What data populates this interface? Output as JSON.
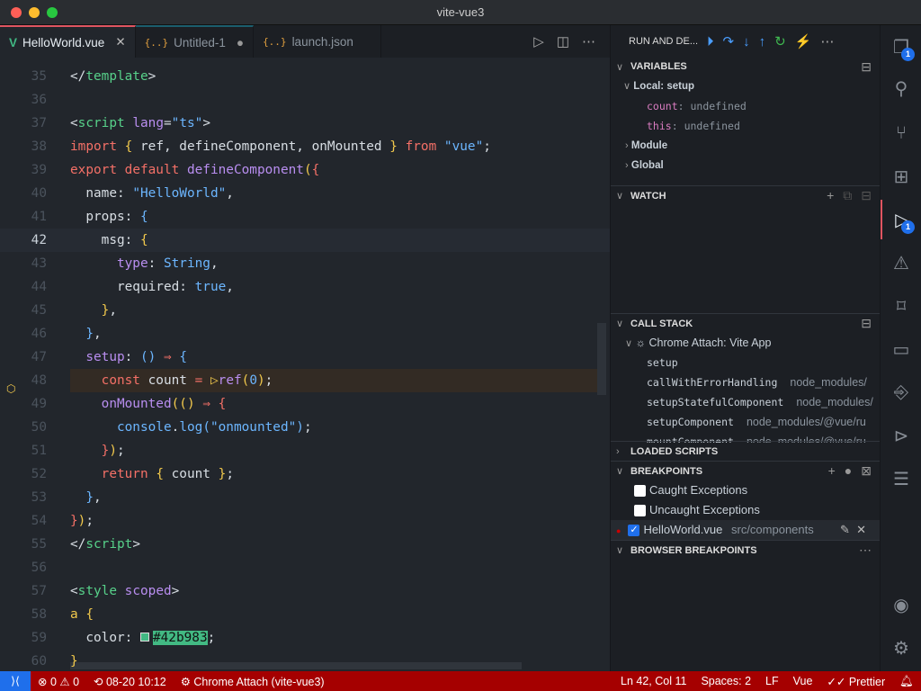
{
  "window": {
    "title": "vite-vue3"
  },
  "tabs": [
    {
      "label": "HelloWorld.vue",
      "icon": "vue-icon",
      "state": "active-close"
    },
    {
      "label": "Untitled-1",
      "icon": "json-icon",
      "state": "dirty"
    },
    {
      "label": "launch.json",
      "icon": "json-icon",
      "state": "normal"
    }
  ],
  "editor": {
    "current_line": 42,
    "stopped_line": 48,
    "lines": [
      {
        "n": 35,
        "t": [
          [
            "pu",
            "</"
          ],
          [
            "tag",
            "template"
          ],
          [
            "pu",
            ">"
          ]
        ]
      },
      {
        "n": 36,
        "t": []
      },
      {
        "n": 37,
        "t": [
          [
            "pu",
            "<"
          ],
          [
            "tag",
            "script"
          ],
          [
            "pl",
            " "
          ],
          [
            "attr",
            "lang"
          ],
          [
            "pu",
            "="
          ],
          [
            "str",
            "\"ts\""
          ],
          [
            "pu",
            ">"
          ]
        ]
      },
      {
        "n": 38,
        "t": [
          [
            "kw",
            "import"
          ],
          [
            "pl",
            " "
          ],
          [
            "br",
            "{"
          ],
          [
            "pl",
            " ref, defineComponent, onMounted "
          ],
          [
            "br",
            "}"
          ],
          [
            "pl",
            " "
          ],
          [
            "kw",
            "from"
          ],
          [
            "pl",
            " "
          ],
          [
            "str",
            "\"vue\""
          ],
          [
            "pl",
            ";"
          ]
        ]
      },
      {
        "n": 39,
        "t": [
          [
            "kw",
            "export"
          ],
          [
            "pl",
            " "
          ],
          [
            "kw",
            "default"
          ],
          [
            "pl",
            " "
          ],
          [
            "fn",
            "defineComponent"
          ],
          [
            "br",
            "("
          ],
          [
            "kw",
            "{"
          ]
        ]
      },
      {
        "n": 40,
        "t": [
          [
            "pl",
            "  name: "
          ],
          [
            "str",
            "\"HelloWorld\""
          ],
          [
            "pl",
            ","
          ]
        ]
      },
      {
        "n": 41,
        "t": [
          [
            "pl",
            "  props: "
          ],
          [
            "str",
            "{"
          ]
        ]
      },
      {
        "n": 42,
        "t": [
          [
            "pl",
            "    msg: "
          ],
          [
            "br",
            "{"
          ]
        ]
      },
      {
        "n": 43,
        "t": [
          [
            "pl",
            "      "
          ],
          [
            "fn",
            "type"
          ],
          [
            "pl",
            ": "
          ],
          [
            "str",
            "String"
          ],
          [
            "pl",
            ","
          ]
        ]
      },
      {
        "n": 44,
        "t": [
          [
            "pl",
            "      required: "
          ],
          [
            "str",
            "true"
          ],
          [
            "pl",
            ","
          ]
        ]
      },
      {
        "n": 45,
        "t": [
          [
            "pl",
            "    "
          ],
          [
            "br",
            "}"
          ],
          [
            "pl",
            ","
          ]
        ]
      },
      {
        "n": 46,
        "t": [
          [
            "pl",
            "  "
          ],
          [
            "str",
            "}"
          ],
          [
            "pl",
            ","
          ]
        ]
      },
      {
        "n": 47,
        "t": [
          [
            "pl",
            "  "
          ],
          [
            "fn",
            "setup"
          ],
          [
            "pl",
            ": "
          ],
          [
            "str",
            "()"
          ],
          [
            "pl",
            " "
          ],
          [
            "arr",
            "⇒"
          ],
          [
            "pl",
            " "
          ],
          [
            "str",
            "{"
          ]
        ]
      },
      {
        "n": 48,
        "t": [
          [
            "pl",
            "    "
          ],
          [
            "kw",
            "const"
          ],
          [
            "pl",
            " count "
          ],
          [
            "arr",
            "="
          ],
          [
            "pl",
            " "
          ],
          [
            "br",
            "▷"
          ],
          [
            "fn",
            "ref"
          ],
          [
            "br",
            "("
          ],
          [
            "num",
            "0"
          ],
          [
            "br",
            ")"
          ],
          [
            "pl",
            ";"
          ]
        ]
      },
      {
        "n": 49,
        "t": [
          [
            "pl",
            "    "
          ],
          [
            "fn",
            "onMounted"
          ],
          [
            "br",
            "(()"
          ],
          [
            "pl",
            " "
          ],
          [
            "arr",
            "⇒"
          ],
          [
            "pl",
            " "
          ],
          [
            "kw",
            "{"
          ]
        ]
      },
      {
        "n": 50,
        "t": [
          [
            "pl",
            "      "
          ],
          [
            "str",
            "console"
          ],
          [
            "pl",
            "."
          ],
          [
            "str",
            "log"
          ],
          [
            "str",
            "(\"onmounted\")"
          ],
          [
            "pl",
            ";"
          ]
        ]
      },
      {
        "n": 51,
        "t": [
          [
            "pl",
            "    "
          ],
          [
            "kw",
            "}"
          ],
          [
            "br",
            ")"
          ],
          [
            "pl",
            ";"
          ]
        ]
      },
      {
        "n": 52,
        "t": [
          [
            "pl",
            "    "
          ],
          [
            "kw",
            "return"
          ],
          [
            "pl",
            " "
          ],
          [
            "br",
            "{"
          ],
          [
            "pl",
            " count "
          ],
          [
            "br",
            "}"
          ],
          [
            "pl",
            ";"
          ]
        ]
      },
      {
        "n": 53,
        "t": [
          [
            "pl",
            "  "
          ],
          [
            "str",
            "}"
          ],
          [
            "pl",
            ","
          ]
        ]
      },
      {
        "n": 54,
        "t": [
          [
            "kw",
            "}"
          ],
          [
            "br",
            ")"
          ],
          [
            "pl",
            ";"
          ]
        ]
      },
      {
        "n": 55,
        "t": [
          [
            "pu",
            "</"
          ],
          [
            "tag",
            "script"
          ],
          [
            "pu",
            ">"
          ]
        ]
      },
      {
        "n": 56,
        "t": []
      },
      {
        "n": 57,
        "t": [
          [
            "pu",
            "<"
          ],
          [
            "tag",
            "style"
          ],
          [
            "pl",
            " "
          ],
          [
            "attr",
            "scoped"
          ],
          [
            "pu",
            ">"
          ]
        ]
      },
      {
        "n": 58,
        "t": [
          [
            "br",
            "a"
          ],
          [
            "pl",
            " "
          ],
          [
            "br",
            "{"
          ]
        ]
      },
      {
        "n": 59,
        "t": [
          [
            "pl",
            "  "
          ],
          [
            "pl",
            "color: "
          ],
          [
            "swatch",
            "#42b983"
          ],
          [
            "pl",
            ";"
          ]
        ]
      },
      {
        "n": 60,
        "t": [
          [
            "br",
            "}"
          ]
        ]
      }
    ]
  },
  "debug": {
    "title": "RUN AND DE...",
    "toolbar": [
      "continue-icon",
      "step-over-icon",
      "step-into-icon",
      "step-out-icon",
      "restart-icon",
      "disconnect-icon",
      "more-icon"
    ],
    "variables": {
      "title": "VARIABLES",
      "scope": "Local: setup",
      "vars": [
        {
          "name": "count",
          "value": "undefined"
        },
        {
          "name": "this",
          "value": "undefined"
        }
      ],
      "others": [
        "Module",
        "Global"
      ]
    },
    "watch": {
      "title": "WATCH"
    },
    "call_stack": {
      "title": "CALL STACK",
      "session": "Chrome Attach: Vite App",
      "frames": [
        {
          "name": "setup",
          "file": ""
        },
        {
          "name": "callWithErrorHandling",
          "file": "node_modules/"
        },
        {
          "name": "setupStatefulComponent",
          "file": "node_modules/"
        },
        {
          "name": "setupComponent",
          "file": "node_modules/@vue/ru"
        },
        {
          "name": "mountComponent",
          "file": "node_modules/@vue/ru"
        }
      ]
    },
    "loaded_scripts": {
      "title": "LOADED SCRIPTS"
    },
    "breakpoints": {
      "title": "BREAKPOINTS",
      "items": [
        {
          "label": "Caught Exceptions",
          "checked": false
        },
        {
          "label": "Uncaught Exceptions",
          "checked": false
        },
        {
          "label": "HelloWorld.vue",
          "path": "src/components",
          "checked": true
        }
      ]
    },
    "browser_breakpoints": {
      "title": "BROWSER BREAKPOINTS"
    }
  },
  "activity": {
    "explorer_badge": "1",
    "debug_badge": "1"
  },
  "status": {
    "errors": "0",
    "warnings": "0",
    "timeline": "08-20 10:12",
    "debug_session": "Chrome Attach (vite-vue3)",
    "position": "Ln 42, Col 11",
    "spaces": "Spaces: 2",
    "eol": "LF",
    "language": "Vue",
    "formatter": "Prettier"
  },
  "colors": {
    "statusbar": "#a50000",
    "accent": "#1f6feb",
    "active_tab_border": "#e05561",
    "swatch": "#42b983"
  }
}
